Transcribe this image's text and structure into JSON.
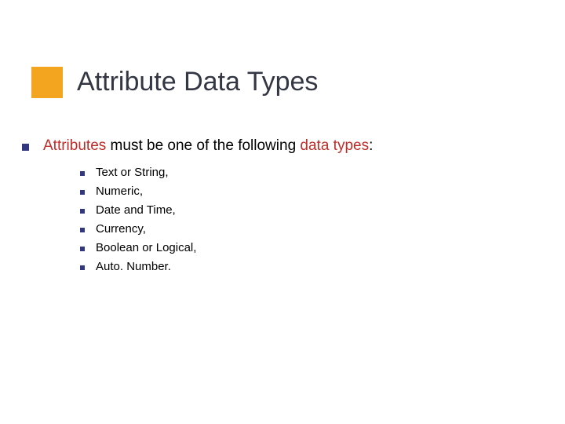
{
  "title": "Attribute Data Types",
  "main": {
    "prefix": "Attributes",
    "mid": " must be one of the following ",
    "highlight": "data types",
    "suffix": ":"
  },
  "items": [
    "Text or String,",
    "Numeric,",
    "Date and Time,",
    "Currency,",
    "Boolean or Logical,",
    "Auto. Number."
  ]
}
